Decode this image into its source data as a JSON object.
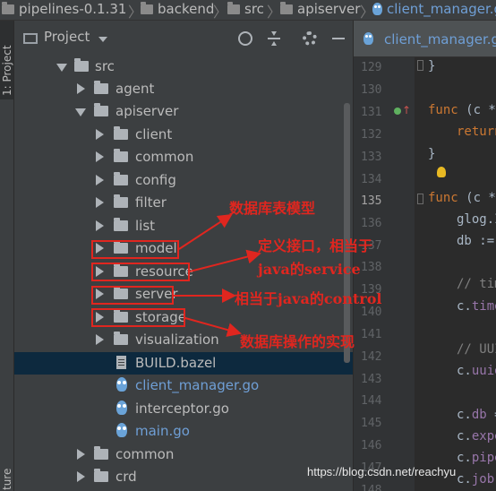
{
  "breadcrumb": {
    "items": [
      "pipelines-0.1.31",
      "backend",
      "src",
      "apiserver",
      "client_manager.go"
    ]
  },
  "tool_window": {
    "left_stripe_top": "1: Project",
    "left_stripe_bottom": "ture"
  },
  "project_panel": {
    "title": "Project",
    "icons": [
      "crosshair-icon",
      "collapse-icon",
      "gear-icon",
      "minimize-icon"
    ]
  },
  "tree": [
    {
      "label": "src",
      "type": "folder",
      "expanded": true
    },
    {
      "label": "agent",
      "type": "folder",
      "expanded": false
    },
    {
      "label": "apiserver",
      "type": "folder",
      "expanded": true
    },
    {
      "label": "client",
      "type": "folder",
      "expanded": false
    },
    {
      "label": "common",
      "type": "folder",
      "expanded": false
    },
    {
      "label": "config",
      "type": "folder",
      "expanded": false
    },
    {
      "label": "filter",
      "type": "folder",
      "expanded": false
    },
    {
      "label": "list",
      "type": "folder",
      "expanded": false
    },
    {
      "label": "model",
      "type": "folder",
      "expanded": false
    },
    {
      "label": "resource",
      "type": "folder",
      "expanded": false
    },
    {
      "label": "server",
      "type": "folder",
      "expanded": false
    },
    {
      "label": "storage",
      "type": "folder",
      "expanded": false
    },
    {
      "label": "visualization",
      "type": "folder",
      "expanded": false
    },
    {
      "label": "BUILD.bazel",
      "type": "file",
      "selected": true
    },
    {
      "label": "client_manager.go",
      "type": "go"
    },
    {
      "label": "interceptor.go",
      "type": "go"
    },
    {
      "label": "main.go",
      "type": "go"
    },
    {
      "label": "common",
      "type": "folder",
      "expanded": false
    },
    {
      "label": "crd",
      "type": "folder",
      "expanded": false
    }
  ],
  "editor": {
    "tab_label": "client_manager.go",
    "line_numbers": [
      "129",
      "130",
      "131",
      "132",
      "133",
      "134",
      "135",
      "136",
      "137",
      "138",
      "139",
      "140",
      "141",
      "142",
      "143",
      "144",
      "145",
      "146",
      "147",
      "148"
    ],
    "current_line": "135",
    "code": {
      "l129": "}",
      "l131_kw": "func",
      "l131_rest": " (c *C",
      "l132_kw": "return",
      "l133": "}",
      "l135_kw": "func",
      "l135_rest": " (c *C",
      "l136": "glog.I",
      "l137": "db :=",
      "l139": "// tim",
      "l140_obj": "c.",
      "l140_fld": "time",
      "l142": "// UUI",
      "l143_obj": "c.",
      "l143_fld": "uuid",
      "l145_obj": "c.",
      "l145_fld": "db",
      "l145_rest": " =",
      "l146_obj": "c.",
      "l146_fld": "expe",
      "l147_obj": "c.",
      "l147_fld": "pipe",
      "l148_obj": "c.",
      "l148_fld": "job"
    }
  },
  "annotations": {
    "model_note": "数据库表模型",
    "resource_note_line1": "定义接口，相当于",
    "resource_note_line2": "java的service",
    "server_note": "相当于java的control",
    "storage_note": "数据库操作的实现"
  },
  "colors": {
    "annotation_red": "#e0261f",
    "selection": "#0d293e",
    "go_file": "#6f9fd6"
  },
  "watermark": "https://blog.csdn.net/reachyu"
}
